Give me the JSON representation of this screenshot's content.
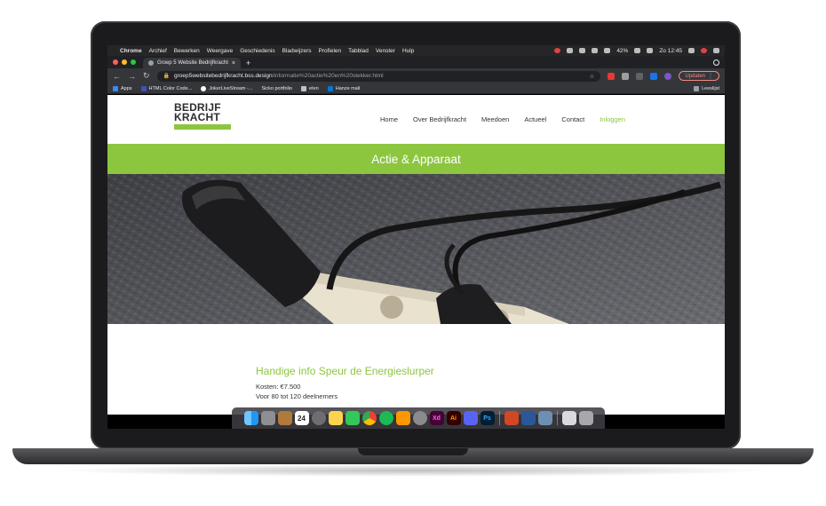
{
  "menubar": {
    "apple": "",
    "app_name": "Chrome",
    "items": [
      "Archief",
      "Bewerken",
      "Weergave",
      "Geschiedenis",
      "Bladwijzers",
      "Profielen",
      "Tabblad",
      "Venster",
      "Hulp"
    ],
    "battery": "42%",
    "clock": "Zo 12:45"
  },
  "browser": {
    "tab_title": "Groep 5 Website Bedrijfkracht",
    "tab_close": "×",
    "new_tab": "+",
    "url_host": "groep5websitebedrijfkracht.bss.design",
    "url_path": "/informatie%20actie%20en%20stekker.html",
    "update_label": "Updaten",
    "bookmarks": [
      "Apps",
      "HTML Color Code...",
      "JokerLiveStream -...",
      "Sicko portfolio",
      "eten",
      "Hanze mail"
    ],
    "reading_list": "Leeslijst"
  },
  "site": {
    "logo_line1": "BEDRIJF",
    "logo_line2": "KRACHT",
    "nav": [
      "Home",
      "Over Bedrijfkracht",
      "Meedoen",
      "Actueel",
      "Contact",
      "Inloggen"
    ],
    "banner_title": "Actie & Apparaat",
    "content_title": "Handige info Speur de Energieslurper",
    "content_lines": [
      "Kosten: €7.500",
      "Voor 80 tot 120 deelnemers"
    ]
  },
  "colors": {
    "brand_green": "#8cc63f",
    "chrome_dark": "#202124",
    "chrome_toolbar": "#35363a"
  },
  "dock": {
    "icons": [
      "finder-icon",
      "launchpad-icon",
      "notes-icon",
      "calendar-icon",
      "safari-icon",
      "stickies-icon",
      "numbers-icon",
      "chrome-icon",
      "spotify-icon",
      "sublime-icon",
      "system-preferences-icon",
      "xd-icon",
      "illustrator-icon",
      "discord-icon",
      "photoshop-icon",
      "powerpoint-icon",
      "word-icon",
      "preview-icon",
      "terminal-icon",
      "trash-icon"
    ],
    "calendar_day": "24"
  }
}
